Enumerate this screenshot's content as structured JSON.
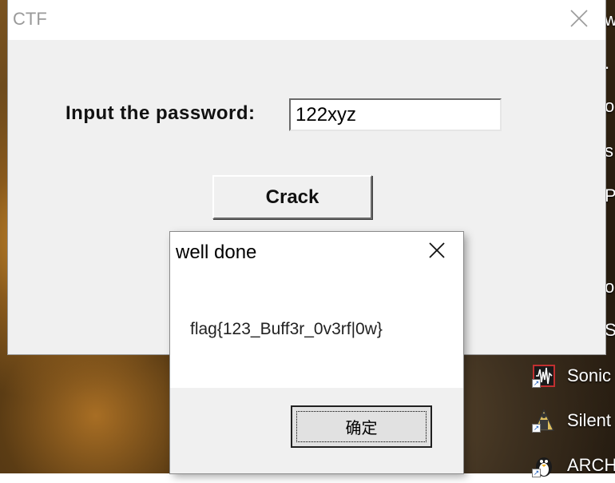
{
  "desktop": {
    "shortcuts": [
      {
        "label": "Sonic",
        "icon": "audio-waveform-icon"
      },
      {
        "label": "Silent",
        "icon": "installer-icon"
      },
      {
        "label": "ARCH",
        "icon": "penguin-icon"
      }
    ],
    "edge_labels": [
      "w",
      ".",
      "o",
      "s",
      "P",
      "o",
      "S"
    ]
  },
  "ctf_window": {
    "title": "CTF",
    "prompt_label": "Input the password:",
    "password_value": "122xyz",
    "crack_button_label": "Crack"
  },
  "message_box": {
    "title": "well done",
    "message": "flag{123_Buff3r_0v3rf|0w}",
    "ok_button_label": "确定"
  },
  "colors": {
    "window_bg": "#f0f0f0",
    "titlebar_bg": "#ffffff",
    "title_text_inactive": "#9a9a9a"
  }
}
